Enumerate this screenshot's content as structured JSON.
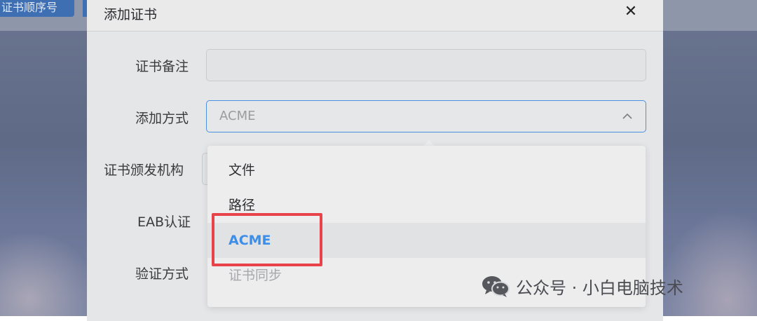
{
  "background": {
    "button_label": "证书顺序号"
  },
  "modal": {
    "title": "添加证书",
    "close_glyph": "✕"
  },
  "form": {
    "remark_label": "证书备注",
    "remark_value": "",
    "method_label": "添加方式",
    "method_value": "ACME",
    "issuer_label": "证书颁发机构",
    "eab_label": "EAB认证",
    "verify_label": "验证方式"
  },
  "dropdown": {
    "options": [
      {
        "label": "文件",
        "state": "normal"
      },
      {
        "label": "路径",
        "state": "normal"
      },
      {
        "label": "ACME",
        "state": "selected"
      },
      {
        "label": "证书同步",
        "state": "disabled"
      }
    ]
  },
  "watermark": {
    "text": "公众号 · 小白电脑技术",
    "icon": "wechat-icon"
  },
  "colors": {
    "accent": "#3d8ee8",
    "highlight": "#e8434a",
    "focus_border": "#4a8fe0"
  }
}
